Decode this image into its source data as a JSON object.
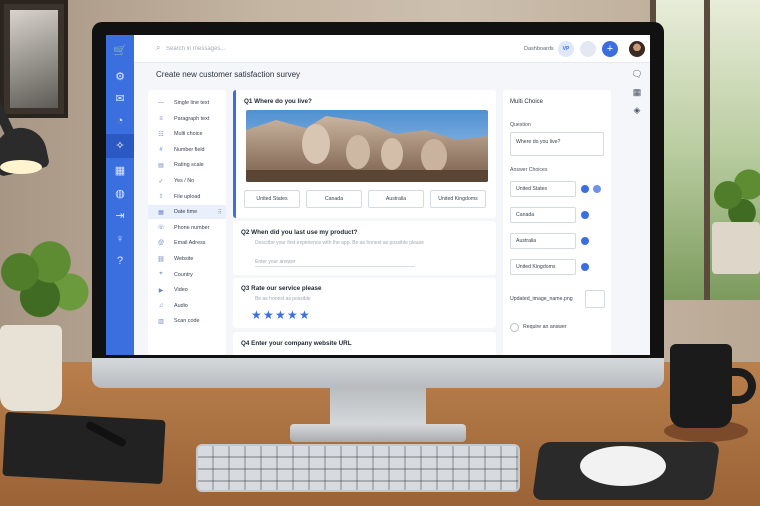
{
  "app": {
    "search_placeholder": "Search in messages...",
    "dashboards_label": "Dashboards",
    "user_initials": "VP",
    "add_label": "+"
  },
  "page": {
    "title": "Create new customer satisfaction survey"
  },
  "sidebar_icons": [
    "cart-icon",
    "gear-icon",
    "mail-icon",
    "speedometer-icon",
    "magic-icon",
    "calendar-icon",
    "globe-icon",
    "export-icon",
    "lightbulb-icon",
    "help-icon"
  ],
  "field_types": {
    "items": [
      {
        "icon": "―",
        "label": "Single line text"
      },
      {
        "icon": "≡",
        "label": "Paragraph text"
      },
      {
        "icon": "☷",
        "label": "Multi choice"
      },
      {
        "icon": "#",
        "label": "Number field"
      },
      {
        "icon": "▤",
        "label": "Rating scale"
      },
      {
        "icon": "✓",
        "label": "Yes / No"
      },
      {
        "icon": "⇪",
        "label": "File upload"
      },
      {
        "icon": "▦",
        "label": "Date time"
      },
      {
        "icon": "☏",
        "label": "Phone number"
      },
      {
        "icon": "@",
        "label": "Email Adress"
      },
      {
        "icon": "⛓",
        "label": "Website"
      },
      {
        "icon": "⌖",
        "label": "Country"
      },
      {
        "icon": "▶",
        "label": "Video"
      },
      {
        "icon": "♫",
        "label": "Audio"
      },
      {
        "icon": "▥",
        "label": "Scan code"
      }
    ],
    "drag_handle": "⠿"
  },
  "questions": {
    "q1": {
      "title": "Q1  Where do you live?",
      "choices": [
        "United States",
        "Canada",
        "Australia",
        "United Kingdoms"
      ]
    },
    "q2": {
      "title": "Q2  When did you last use my product?",
      "description": "Describe your first experience with the app. Be as honest as possible please",
      "placeholder": "Enter your answer"
    },
    "q3": {
      "title": "Q3  Rate our service please",
      "description": "Be as honest as possible",
      "rating": 5,
      "max_rating": 5
    },
    "q4": {
      "title": "Q4  Enter your company website URL"
    }
  },
  "panel": {
    "title": "Multi Choice",
    "question_label": "Question",
    "question_value": "Where do you live?",
    "choices_label": "Answer Choices",
    "choices": [
      "United States",
      "Canada",
      "Australia",
      "United Kingdoms"
    ],
    "image_name": "Updated_image_name.png",
    "required_label": "Require an answer"
  },
  "toolbar_icons": [
    "chat-icon",
    "calendar-icon",
    "layers-icon"
  ],
  "colors": {
    "accent": "#3b6fe0",
    "sidebar": "#3b6fe0",
    "screen_bg": "#f4f6f9"
  }
}
